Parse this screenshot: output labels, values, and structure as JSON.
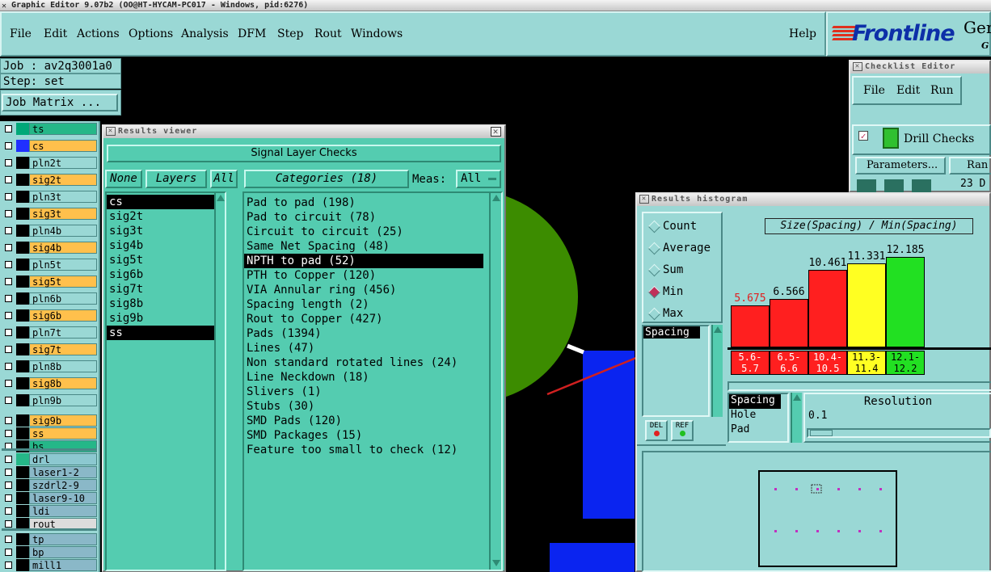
{
  "app": {
    "title": "Graphic Editor 9.07b2 (OO@HT-HYCAM-PC017 - Windows, pid:6276)",
    "menu": [
      "File",
      "Edit",
      "Actions",
      "Options",
      "Analysis",
      "DFM",
      "Step",
      "Rout",
      "Windows"
    ],
    "help": "Help",
    "brand": "Frontline",
    "brand_suffix": "Ger",
    "brand_suffix2": "G"
  },
  "job": {
    "job_label": "Job : av2q3001a0",
    "step_label": "Step: set",
    "job_matrix": "Job Matrix ..."
  },
  "layers": [
    {
      "name": "ts",
      "color": "#00a878",
      "bg": "#25b788"
    },
    {
      "name": "cs",
      "color": "#2030ff",
      "bg": "#ffc04c"
    },
    {
      "name": "pln2t",
      "color": "#000",
      "bg": "#9ad8d5"
    },
    {
      "name": "sig2t",
      "color": "#000",
      "bg": "#ffc04c"
    },
    {
      "name": "pln3t",
      "color": "#000",
      "bg": "#9ad8d5"
    },
    {
      "name": "sig3t",
      "color": "#000",
      "bg": "#ffc04c"
    },
    {
      "name": "pln4b",
      "color": "#000",
      "bg": "#9ad8d5"
    },
    {
      "name": "sig4b",
      "color": "#000",
      "bg": "#ffc04c"
    },
    {
      "name": "pln5t",
      "color": "#000",
      "bg": "#9ad8d5"
    },
    {
      "name": "sig5t",
      "color": "#000",
      "bg": "#ffc04c"
    },
    {
      "name": "pln6b",
      "color": "#000",
      "bg": "#9ad8d5"
    },
    {
      "name": "sig6b",
      "color": "#000",
      "bg": "#ffc04c"
    },
    {
      "name": "pln7t",
      "color": "#000",
      "bg": "#9ad8d5"
    },
    {
      "name": "sig7t",
      "color": "#000",
      "bg": "#ffc04c"
    },
    {
      "name": "pln8b",
      "color": "#000",
      "bg": "#9ad8d5"
    },
    {
      "name": "sig8b",
      "color": "#000",
      "bg": "#ffc04c"
    },
    {
      "name": "pln9b",
      "color": "#000",
      "bg": "#9ad8d5"
    },
    {
      "name": "sig9b",
      "color": "#000",
      "bg": "#ffc04c"
    },
    {
      "name": "ss",
      "color": "#000",
      "bg": "#ffc04c"
    },
    {
      "name": "bs",
      "color": "#000",
      "bg": "#25b788"
    },
    {
      "name": "drl",
      "color": "#25b788",
      "bg": "#8cc8d0"
    },
    {
      "name": "laser1-2",
      "color": "#000",
      "bg": "#8ab8c8"
    },
    {
      "name": "szdrl2-9",
      "color": "#000",
      "bg": "#8ab8c8"
    },
    {
      "name": "laser9-10",
      "color": "#000",
      "bg": "#8ab8c8"
    },
    {
      "name": "ldi",
      "color": "#000",
      "bg": "#8ab8c8"
    },
    {
      "name": "rout",
      "color": "#000",
      "bg": "#dcdcdc"
    },
    {
      "name": "tp",
      "color": "#000",
      "bg": "#8ab8c8"
    },
    {
      "name": "bp",
      "color": "#000",
      "bg": "#8ab8c8"
    },
    {
      "name": "mill1",
      "color": "#000",
      "bg": "#8ab8c8"
    }
  ],
  "results_viewer": {
    "title": "Results viewer",
    "header": "Signal Layer Checks",
    "none_btn": "None",
    "layers_btn": "Layers",
    "all_btn": "All",
    "categories_btn": "Categories (18)",
    "meas_label": "Meas:",
    "meas_value": "All",
    "layer_list": [
      "cs",
      "sig2t",
      "sig3t",
      "sig4b",
      "sig5t",
      "sig6b",
      "sig7t",
      "sig8b",
      "sig9b",
      "ss"
    ],
    "categories": [
      "Pad to pad (198)",
      "Pad to circuit (78)",
      "Circuit to circuit (25)",
      "Same Net Spacing (48)",
      "NPTH to pad (52)",
      "PTH to Copper (120)",
      "VIA Annular ring (456)",
      "Spacing length (2)",
      "Rout to Copper (427)",
      "Pads (1394)",
      "Lines (47)",
      "Non standard rotated lines (24)",
      "Line Neckdown (18)",
      "Slivers (1)",
      "Stubs (30)",
      "SMD Pads (120)",
      "SMD Packages (15)",
      "Feature too small to check (12)"
    ]
  },
  "checklist": {
    "title": "Checklist Editor",
    "menu": [
      "File",
      "Edit",
      "Run"
    ],
    "item": "Drill Checks",
    "params_btn": "Parameters...",
    "ran_btn": "Ran",
    "date": "23 D"
  },
  "histogram": {
    "title": "Results histogram",
    "modes": [
      "Count",
      "Average",
      "Sum",
      "Min",
      "Max"
    ],
    "selected_mode": "Min",
    "list_item": "Spacing",
    "del": "DEL",
    "ref": "REF",
    "chart_title": "Size(Spacing) / Min(Spacing)",
    "attr_list": [
      "Spacing",
      "Hole",
      "Pad"
    ],
    "resolution_label": "Resolution",
    "resolution_value": "0.1"
  },
  "chart_data": {
    "type": "bar",
    "title": "Size(Spacing) / Min(Spacing)",
    "categories": [
      "5.6-5.7",
      "6.5-6.6",
      "10.4-10.5",
      "11.3-11.4",
      "12.1-12.2"
    ],
    "values": [
      5.675,
      6.566,
      10.461,
      11.331,
      12.185
    ],
    "value_labels": [
      "5.675",
      "6.566",
      "10.461",
      "11.331",
      "12.185"
    ],
    "colors": [
      "#ff1f1f",
      "#ff1f1f",
      "#ff1f1f",
      "#ffff22",
      "#22e022"
    ],
    "ylim": [
      0,
      12.185
    ]
  }
}
